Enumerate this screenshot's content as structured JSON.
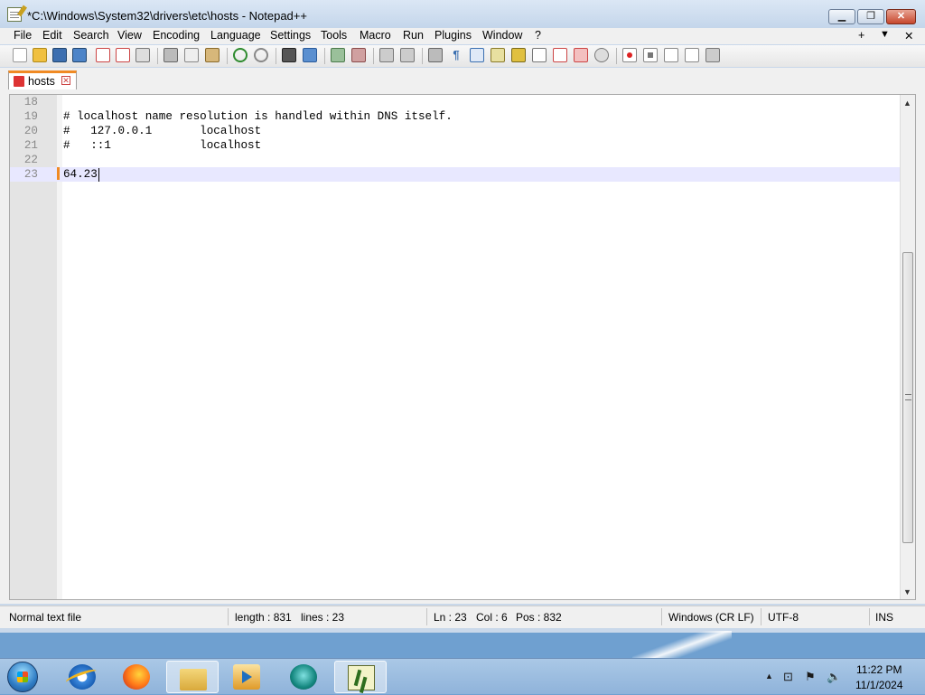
{
  "window": {
    "title": "*C:\\Windows\\System32\\drivers\\etc\\hosts - Notepad++",
    "controls": {
      "minimize": "▁",
      "maximize": "❐",
      "close": "✕"
    }
  },
  "menu": {
    "items": [
      "File",
      "Edit",
      "Search",
      "View",
      "Encoding",
      "Language",
      "Settings",
      "Tools",
      "Macro",
      "Run",
      "Plugins",
      "Window",
      "?"
    ],
    "right": {
      "plus": "+",
      "dropdown": "▼",
      "close": "✕"
    }
  },
  "tab": {
    "label": "hosts",
    "close": "✕"
  },
  "editor": {
    "lines": [
      {
        "num": "18",
        "text": ""
      },
      {
        "num": "19",
        "text": "# localhost name resolution is handled within DNS itself."
      },
      {
        "num": "20",
        "text": "#   127.0.0.1       localhost"
      },
      {
        "num": "21",
        "text": "#   ::1             localhost"
      },
      {
        "num": "22",
        "text": ""
      },
      {
        "num": "23",
        "text": "64.23"
      }
    ],
    "current_line_index": 5
  },
  "status": {
    "file_type": "Normal text file",
    "length": "length : 831",
    "lines": "lines : 23",
    "ln": "Ln : 23",
    "col": "Col : 6",
    "pos": "Pos : 832",
    "eol": "Windows (CR LF)",
    "encoding": "UTF-8",
    "mode": "INS"
  },
  "taskbar": {
    "clock_time": "11:22 PM",
    "clock_date": "11/1/2024",
    "tray": {
      "arrow": "▲",
      "network": "⊡",
      "flag": "⚑",
      "volume": "🔈"
    }
  },
  "colors": {
    "current_line": "#e8e8ff",
    "change_marker": "#f08a24",
    "tab_accent": "#f08a24"
  }
}
